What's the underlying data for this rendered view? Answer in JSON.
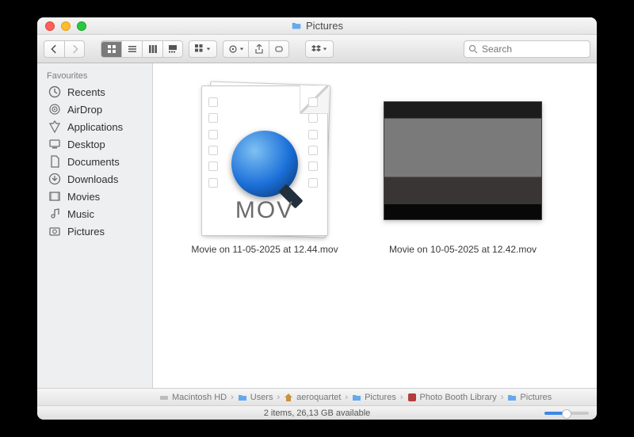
{
  "title": "Pictures",
  "search": {
    "placeholder": "Search"
  },
  "sidebar": {
    "header": "Favourites",
    "items": [
      {
        "icon": "clock",
        "label": "Recents"
      },
      {
        "icon": "airdrop",
        "label": "AirDrop"
      },
      {
        "icon": "apps",
        "label": "Applications"
      },
      {
        "icon": "desktop",
        "label": "Desktop"
      },
      {
        "icon": "doc",
        "label": "Documents"
      },
      {
        "icon": "download",
        "label": "Downloads"
      },
      {
        "icon": "movie",
        "label": "Movies"
      },
      {
        "icon": "music",
        "label": "Music"
      },
      {
        "icon": "pictures",
        "label": "Pictures"
      }
    ]
  },
  "files": [
    {
      "kind": "mov-icon",
      "mov_label": "MOV",
      "name": "Movie on 11-05-2025 at 12.44.mov"
    },
    {
      "kind": "thumb",
      "name": "Movie on 10-05-2025 at 12.42.mov"
    }
  ],
  "path": [
    {
      "icon": "disk",
      "label": "Macintosh HD"
    },
    {
      "icon": "folder",
      "label": "Users"
    },
    {
      "icon": "home",
      "label": "aeroquartet"
    },
    {
      "icon": "folder",
      "label": "Pictures"
    },
    {
      "icon": "app",
      "label": "Photo Booth Library"
    },
    {
      "icon": "folder",
      "label": "Pictures"
    }
  ],
  "status": "2 items, 26,13 GB available"
}
